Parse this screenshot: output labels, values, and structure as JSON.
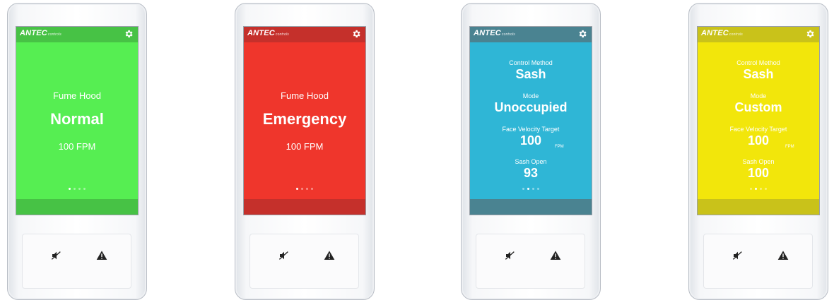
{
  "brand": {
    "name": "ANTEC",
    "sub": "controls"
  },
  "colors": {
    "normal": "#56ee52",
    "emergency": "#ef362c",
    "info_blue": "#2fb6d6",
    "info_yellow": "#f2e60b"
  },
  "devices": [
    {
      "status_label": "Fume Hood",
      "status_value": "Normal",
      "velocity": "100 FPM",
      "page_index": 0
    },
    {
      "status_label": "Fume Hood",
      "status_value": "Emergency",
      "velocity": "100 FPM",
      "page_index": 0
    },
    {
      "control_method_label": "Control Method",
      "control_method_value": "Sash",
      "mode_label": "Mode",
      "mode_value": "Unoccupied",
      "face_velocity_label": "Face Velocity Target",
      "face_velocity_value": "100",
      "face_velocity_unit": "FPM",
      "sash_label": "Sash Open",
      "sash_value": "93",
      "page_index": 1
    },
    {
      "control_method_label": "Control Method",
      "control_method_value": "Sash",
      "mode_label": "Mode",
      "mode_value": "Custom",
      "face_velocity_label": "Face Velocity Target",
      "face_velocity_value": "100",
      "face_velocity_unit": "FPM",
      "sash_label": "Sash Open",
      "sash_value": "100",
      "page_index": 1
    }
  ],
  "icons": {
    "settings": "gear-icon",
    "mute": "mute-icon",
    "alarm": "alarm-icon"
  }
}
